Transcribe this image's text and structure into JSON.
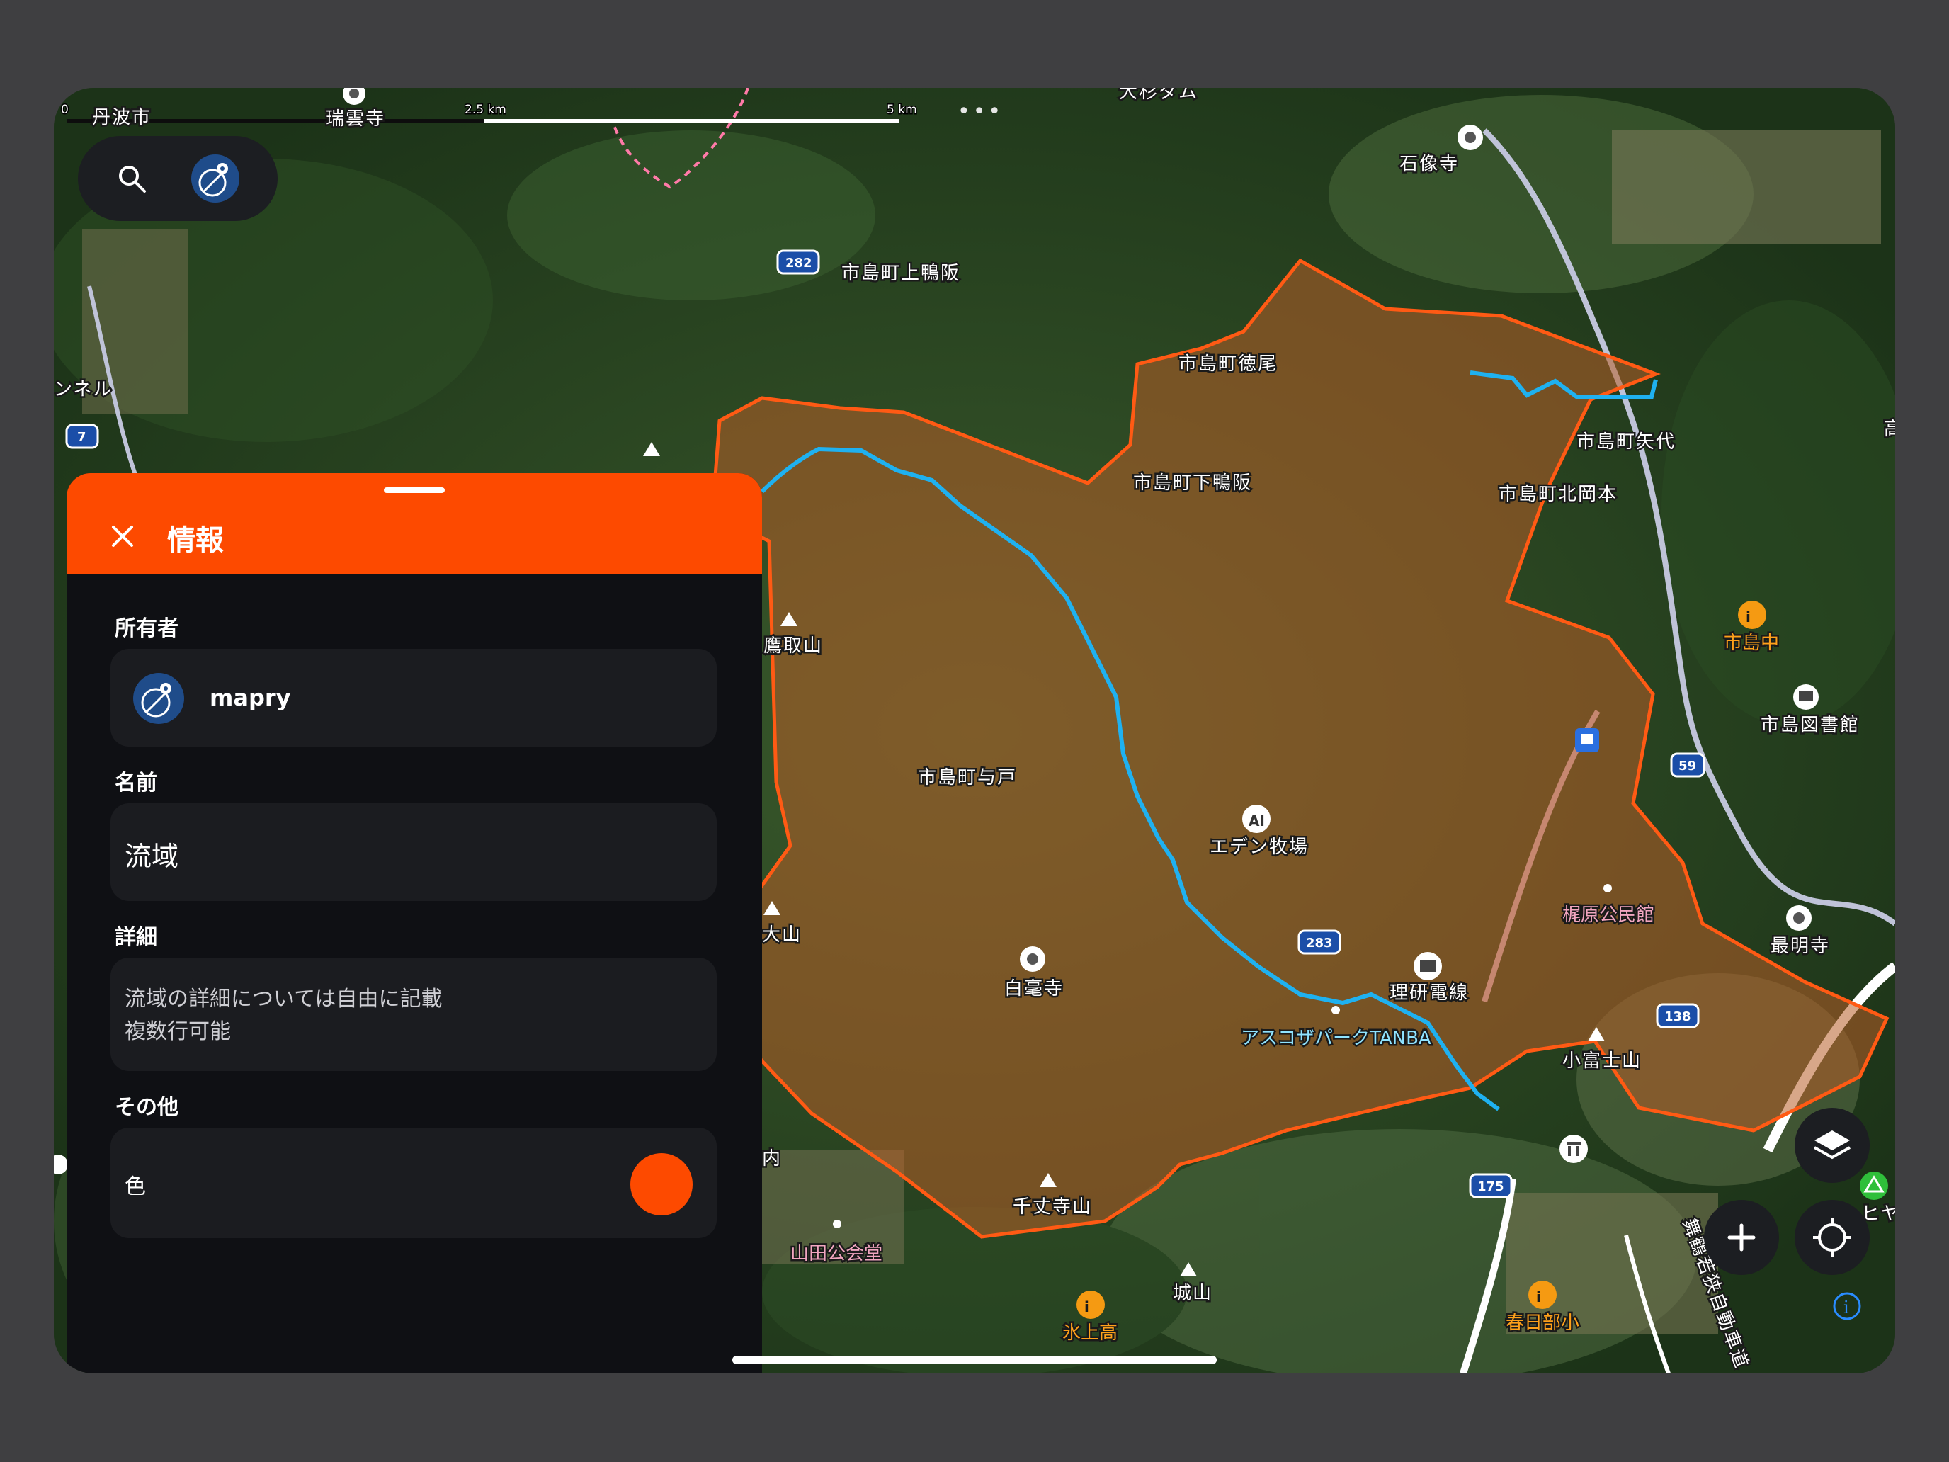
{
  "map": {
    "scale": {
      "zero": "0",
      "mid": "2.5 km",
      "end": "5 km"
    },
    "routes": [
      "282",
      "7",
      "283",
      "59",
      "138",
      "175"
    ],
    "labels": {
      "tamba_city": "丹波市",
      "zuiun_ji": "瑞雲寺",
      "osugi_dam": "大杉ダム",
      "sekizo_ji": "石像寺",
      "kamokamo": "市島町上鴨阪",
      "tokuo": "市島町徳尾",
      "yashiro": "市島町矢代",
      "shimokamo": "市島町下鴨阪",
      "kitaokamoto": "市島町北岡本",
      "takatori": "鷹取山",
      "ichijima_jhs": "市島中",
      "library": "市島図書館",
      "yodo": "市島町与戸",
      "eden": "エデン牧場",
      "kajiwara": "梶原公民館",
      "saimyo_ji": "最明寺",
      "hakugo_ji": "白毫寺",
      "riken": "理研電線",
      "askoza": "アスコザパークTANBA",
      "kofuji": "小富士山",
      "ohyama": "大山",
      "senjo_ji": "千丈寺山",
      "yamada_hall": "山田公会堂",
      "hikami_hs": "氷上高",
      "shiro": "城山",
      "kasuga_es": "春日部小",
      "expressway": "舞鶴若狭自動車道",
      "tunnel": "ンネル",
      "taka": "高",
      "hoshi": "ヒヤ",
      "uchi": "内"
    }
  },
  "search": {
    "icon": "search-icon",
    "avatar_icon": "mapry-logo-icon"
  },
  "panel": {
    "title": "情報",
    "owner_label": "所有者",
    "owner_name": "mapry",
    "name_label": "名前",
    "name_value": "流域",
    "detail_label": "詳細",
    "detail_value": "流域の詳細については自由に記載\n複数行可能",
    "other_label": "その他",
    "color_label": "色",
    "color_value": "#fd4a00"
  },
  "colors": {
    "accent": "#fd4a00",
    "river": "#1fb1f0",
    "boundary": "#ff5a14"
  }
}
